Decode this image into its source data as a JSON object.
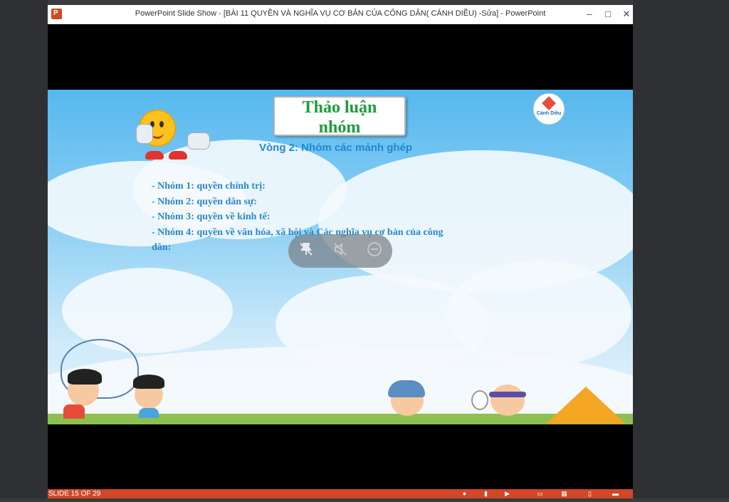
{
  "window": {
    "title": "PowerPoint Slide Show - [BÀI 11 QUYỀN VÀ NGHĨA VỤ CƠ BẢN CỦA CÔNG DÂN( CÁNH DIỀU) -Sửa] - PowerPoint",
    "app_icon_letter": "P",
    "minimize": "–",
    "maximize": "□",
    "close": "✕"
  },
  "slide": {
    "title_line1": "Thảo luận",
    "title_line2": "nhóm",
    "subtitle": "Vòng 2: Nhóm các mảnh ghép",
    "logo_text": "Cánh Diều",
    "items": [
      "- Nhóm 1:  quyền chính trị:",
      "- Nhóm 2: quyền dân sự:",
      "- Nhóm 3: quyền về kinh tế:",
      "- Nhóm 4: quyền về văn hóa, xã hội  và Các nghĩa vụ cơ bản của công",
      "dân:"
    ]
  },
  "overlay": {
    "icons": [
      "pin-off-icon",
      "mute-icon",
      "minus-circle-icon"
    ]
  },
  "statusbar": {
    "slide_counter": "SLIDE 15 OF 29",
    "icons": [
      "notes-icon",
      "normal-view-icon",
      "play-icon",
      "slide-sorter-icon",
      "grid-view-icon",
      "reading-view-icon",
      "display-icon"
    ]
  }
}
